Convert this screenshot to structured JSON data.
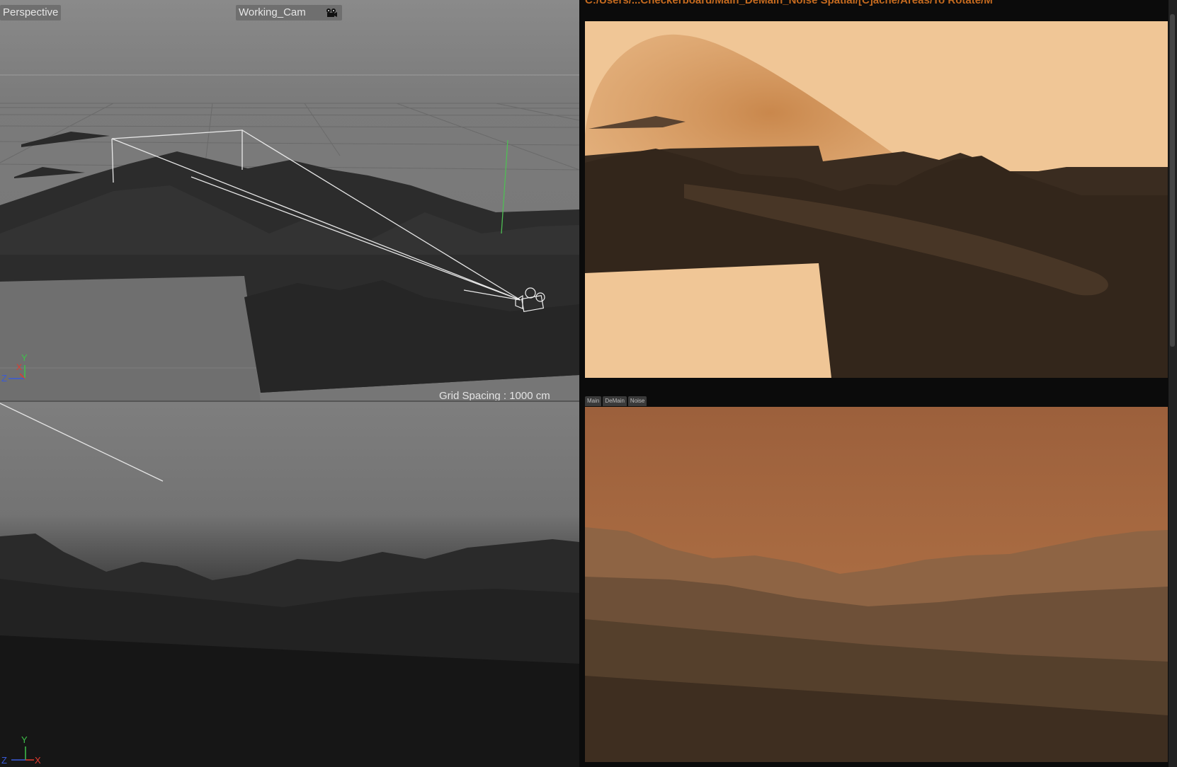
{
  "viewport_top": {
    "view_label": "Perspective",
    "camera_label": "Working_Cam",
    "camera_icon": "camera-icon",
    "grid_spacing": "Grid Spacing : 1000 cm",
    "axis_labels": {
      "y": "Y",
      "x": "X",
      "z": "Z"
    }
  },
  "viewport_bottom": {
    "axis_labels": {
      "y": "Y",
      "x": "X",
      "z": "Z"
    }
  },
  "render_view": {
    "path_text": "C:/Users/...Checkerboard/Main_DeMain_Noise Spatial/[C]ache/Areas/To Rotate/M"
  },
  "mini_tabs": [
    "Main",
    "DeMain",
    "Noise"
  ],
  "colors": {
    "axis_x": "#e03a2f",
    "axis_y": "#3fc24a",
    "axis_z": "#3a5ad8",
    "sand_light": "#f0c696",
    "terrain_dark": "#3a2c20",
    "path_orange": "#c46a1f"
  }
}
